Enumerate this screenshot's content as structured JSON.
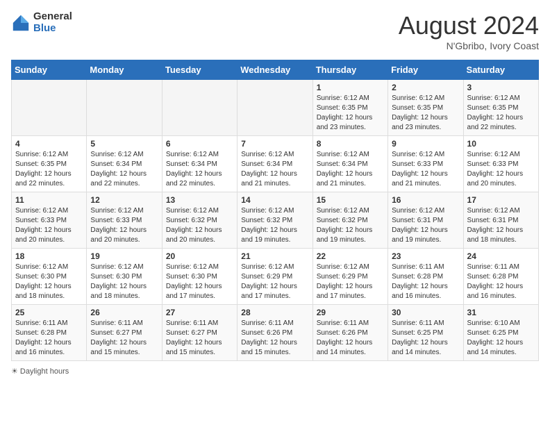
{
  "header": {
    "logo_general": "General",
    "logo_blue": "Blue",
    "title": "August 2024",
    "subtitle": "N'Gbribo, Ivory Coast"
  },
  "days_of_week": [
    "Sunday",
    "Monday",
    "Tuesday",
    "Wednesday",
    "Thursday",
    "Friday",
    "Saturday"
  ],
  "weeks": [
    [
      {
        "day": "",
        "info": ""
      },
      {
        "day": "",
        "info": ""
      },
      {
        "day": "",
        "info": ""
      },
      {
        "day": "",
        "info": ""
      },
      {
        "day": "1",
        "info": "Sunrise: 6:12 AM\nSunset: 6:35 PM\nDaylight: 12 hours\nand 23 minutes."
      },
      {
        "day": "2",
        "info": "Sunrise: 6:12 AM\nSunset: 6:35 PM\nDaylight: 12 hours\nand 23 minutes."
      },
      {
        "day": "3",
        "info": "Sunrise: 6:12 AM\nSunset: 6:35 PM\nDaylight: 12 hours\nand 22 minutes."
      }
    ],
    [
      {
        "day": "4",
        "info": "Sunrise: 6:12 AM\nSunset: 6:35 PM\nDaylight: 12 hours\nand 22 minutes."
      },
      {
        "day": "5",
        "info": "Sunrise: 6:12 AM\nSunset: 6:34 PM\nDaylight: 12 hours\nand 22 minutes."
      },
      {
        "day": "6",
        "info": "Sunrise: 6:12 AM\nSunset: 6:34 PM\nDaylight: 12 hours\nand 22 minutes."
      },
      {
        "day": "7",
        "info": "Sunrise: 6:12 AM\nSunset: 6:34 PM\nDaylight: 12 hours\nand 21 minutes."
      },
      {
        "day": "8",
        "info": "Sunrise: 6:12 AM\nSunset: 6:34 PM\nDaylight: 12 hours\nand 21 minutes."
      },
      {
        "day": "9",
        "info": "Sunrise: 6:12 AM\nSunset: 6:33 PM\nDaylight: 12 hours\nand 21 minutes."
      },
      {
        "day": "10",
        "info": "Sunrise: 6:12 AM\nSunset: 6:33 PM\nDaylight: 12 hours\nand 20 minutes."
      }
    ],
    [
      {
        "day": "11",
        "info": "Sunrise: 6:12 AM\nSunset: 6:33 PM\nDaylight: 12 hours\nand 20 minutes."
      },
      {
        "day": "12",
        "info": "Sunrise: 6:12 AM\nSunset: 6:33 PM\nDaylight: 12 hours\nand 20 minutes."
      },
      {
        "day": "13",
        "info": "Sunrise: 6:12 AM\nSunset: 6:32 PM\nDaylight: 12 hours\nand 20 minutes."
      },
      {
        "day": "14",
        "info": "Sunrise: 6:12 AM\nSunset: 6:32 PM\nDaylight: 12 hours\nand 19 minutes."
      },
      {
        "day": "15",
        "info": "Sunrise: 6:12 AM\nSunset: 6:32 PM\nDaylight: 12 hours\nand 19 minutes."
      },
      {
        "day": "16",
        "info": "Sunrise: 6:12 AM\nSunset: 6:31 PM\nDaylight: 12 hours\nand 19 minutes."
      },
      {
        "day": "17",
        "info": "Sunrise: 6:12 AM\nSunset: 6:31 PM\nDaylight: 12 hours\nand 18 minutes."
      }
    ],
    [
      {
        "day": "18",
        "info": "Sunrise: 6:12 AM\nSunset: 6:30 PM\nDaylight: 12 hours\nand 18 minutes."
      },
      {
        "day": "19",
        "info": "Sunrise: 6:12 AM\nSunset: 6:30 PM\nDaylight: 12 hours\nand 18 minutes."
      },
      {
        "day": "20",
        "info": "Sunrise: 6:12 AM\nSunset: 6:30 PM\nDaylight: 12 hours\nand 17 minutes."
      },
      {
        "day": "21",
        "info": "Sunrise: 6:12 AM\nSunset: 6:29 PM\nDaylight: 12 hours\nand 17 minutes."
      },
      {
        "day": "22",
        "info": "Sunrise: 6:12 AM\nSunset: 6:29 PM\nDaylight: 12 hours\nand 17 minutes."
      },
      {
        "day": "23",
        "info": "Sunrise: 6:11 AM\nSunset: 6:28 PM\nDaylight: 12 hours\nand 16 minutes."
      },
      {
        "day": "24",
        "info": "Sunrise: 6:11 AM\nSunset: 6:28 PM\nDaylight: 12 hours\nand 16 minutes."
      }
    ],
    [
      {
        "day": "25",
        "info": "Sunrise: 6:11 AM\nSunset: 6:28 PM\nDaylight: 12 hours\nand 16 minutes."
      },
      {
        "day": "26",
        "info": "Sunrise: 6:11 AM\nSunset: 6:27 PM\nDaylight: 12 hours\nand 15 minutes."
      },
      {
        "day": "27",
        "info": "Sunrise: 6:11 AM\nSunset: 6:27 PM\nDaylight: 12 hours\nand 15 minutes."
      },
      {
        "day": "28",
        "info": "Sunrise: 6:11 AM\nSunset: 6:26 PM\nDaylight: 12 hours\nand 15 minutes."
      },
      {
        "day": "29",
        "info": "Sunrise: 6:11 AM\nSunset: 6:26 PM\nDaylight: 12 hours\nand 14 minutes."
      },
      {
        "day": "30",
        "info": "Sunrise: 6:11 AM\nSunset: 6:25 PM\nDaylight: 12 hours\nand 14 minutes."
      },
      {
        "day": "31",
        "info": "Sunrise: 6:10 AM\nSunset: 6:25 PM\nDaylight: 12 hours\nand 14 minutes."
      }
    ]
  ],
  "legend": "Daylight hours"
}
